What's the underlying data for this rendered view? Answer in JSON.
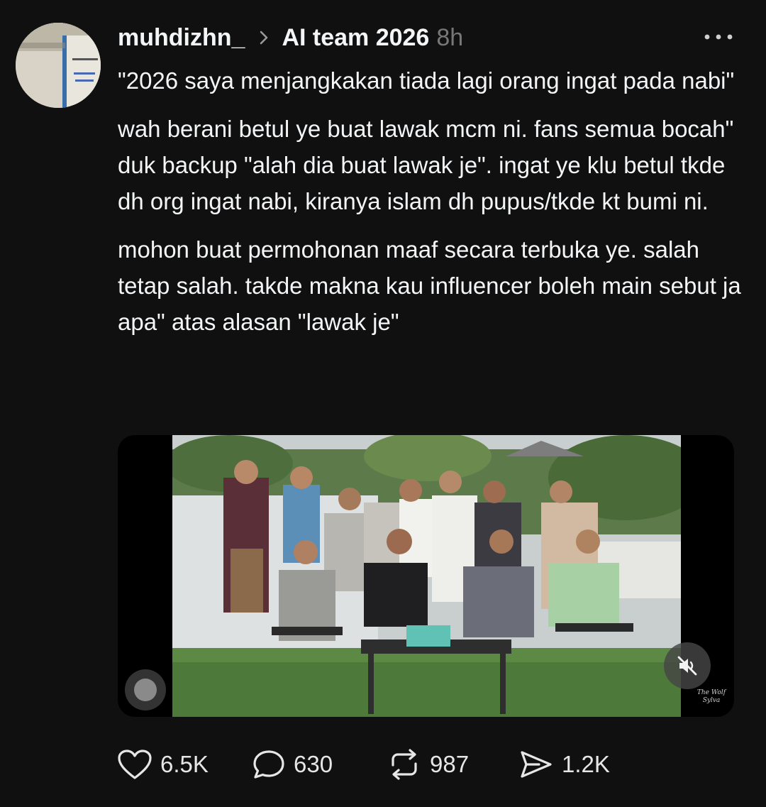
{
  "post": {
    "username": "muhdizhn_",
    "team": "AI team 2026",
    "time": "8h",
    "avatar_icon": "book-cover-avatar",
    "paragraphs": [
      "\"2026 saya menjangkakan tiada lagi orang ingat pada nabi\"",
      "wah berani betul ye buat lawak mcm ni. fans semua bocah\" duk backup \"alah dia buat lawak je\". ingat ye klu betul tkde dh org ingat nabi, kiranya islam dh pupus/tkde kt bumi ni.",
      "mohon buat permohonan maaf secara terbuka ye. salah tetap salah. takde makna kau influencer boleh main sebut ja apa\" atas alasan \"lawak je\""
    ]
  },
  "media": {
    "type": "video",
    "description_icon": "video-thumbnail",
    "muted": true,
    "watermark": "The Wolf Sylva"
  },
  "actions": {
    "likes": "6.5K",
    "replies": "630",
    "reposts": "987",
    "shares": "1.2K"
  },
  "colors": {
    "background": "#101010",
    "text": "#f3f5f7",
    "muted_text": "#777777"
  }
}
